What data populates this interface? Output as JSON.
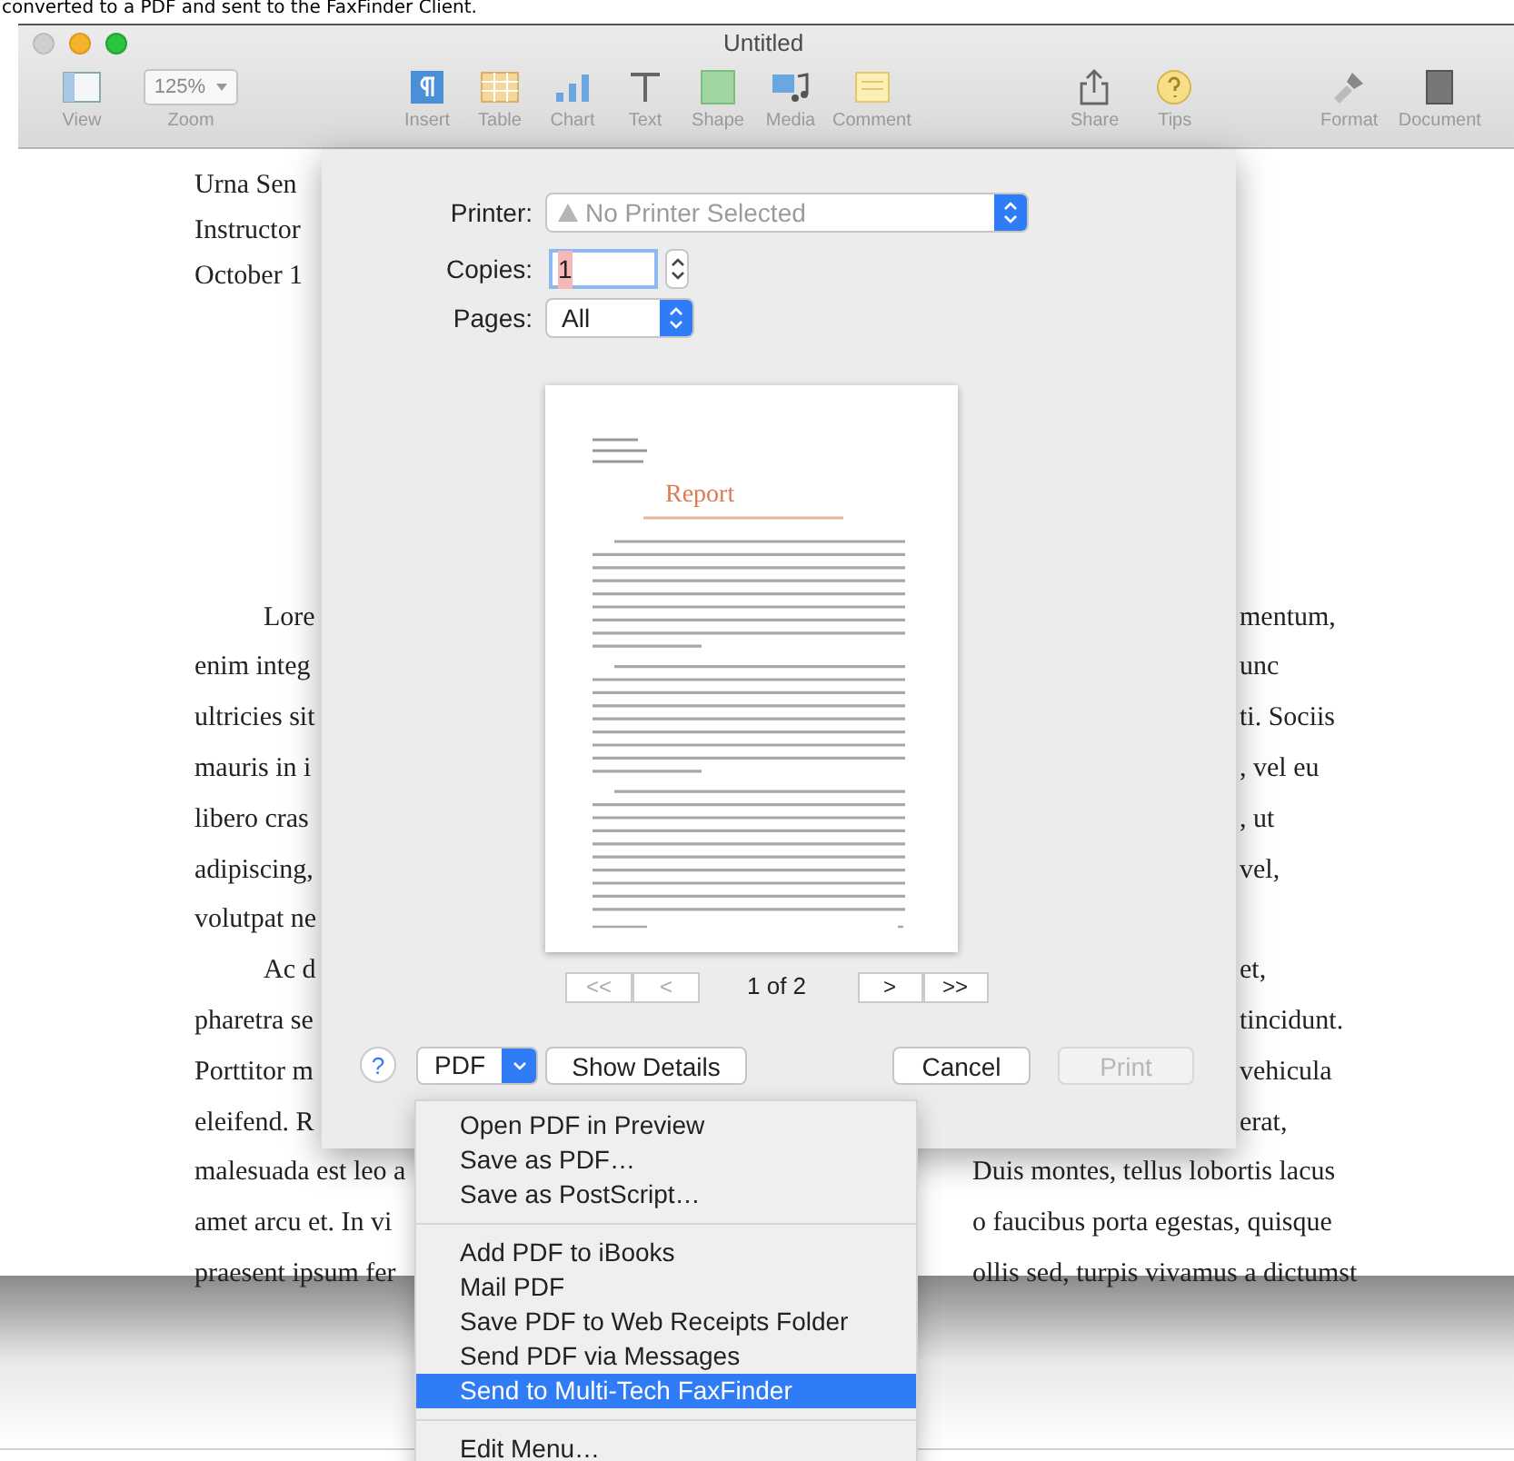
{
  "caption": "converted to a PDF and sent to the FaxFinder Client.",
  "window": {
    "title": "Untitled",
    "toolbar": [
      {
        "items": [
          {
            "kind": "view",
            "label": "View"
          },
          {
            "kind": "zoom",
            "label": "Zoom",
            "value": "125%"
          }
        ]
      },
      {
        "items": [
          {
            "kind": "insert",
            "label": "Insert"
          },
          {
            "kind": "table",
            "label": "Table"
          },
          {
            "kind": "chart",
            "label": "Chart"
          },
          {
            "kind": "text",
            "label": "Text"
          },
          {
            "kind": "shape",
            "label": "Shape"
          },
          {
            "kind": "media",
            "label": "Media"
          },
          {
            "kind": "comment",
            "label": "Comment"
          }
        ]
      },
      {
        "items": [
          {
            "kind": "share",
            "label": "Share"
          },
          {
            "kind": "tips",
            "label": "Tips"
          }
        ]
      },
      {
        "items": [
          {
            "kind": "format",
            "label": "Format"
          },
          {
            "kind": "document",
            "label": "Document"
          }
        ]
      }
    ]
  },
  "document": {
    "header_lines": [
      "Urna Sen",
      "Instructor",
      "October 1"
    ],
    "body_lines": [
      {
        "left": "Lore",
        "right": "mentum,",
        "indent": true
      },
      {
        "left": "enim integ",
        "right": "unc",
        "indent": false
      },
      {
        "left": "ultricies sit",
        "right": "ti. Sociis",
        "indent": false
      },
      {
        "left": "mauris in i",
        "right": ", vel eu",
        "indent": false
      },
      {
        "left": "libero cras",
        "right": ", ut",
        "indent": false
      },
      {
        "left": "adipiscing,",
        "right": "vel,",
        "indent": false
      },
      {
        "left": "volutpat ne",
        "indent": false
      },
      {
        "left": "Ac d",
        "right": "et,",
        "indent": true
      },
      {
        "left": "pharetra se",
        "right": "tincidunt.",
        "indent": false
      },
      {
        "left": "Porttitor m",
        "right": "vehicula",
        "indent": false
      },
      {
        "left": "eleifend. R",
        "right": "erat,",
        "indent": false
      }
    ],
    "lines_below_dialog": [
      {
        "left": "malesuada est leo a",
        "right": "Duis montes, tellus lobortis lacus"
      },
      {
        "left": "amet arcu et. In vi",
        "right": "o faucibus porta egestas, quisque"
      },
      {
        "left": "praesent ipsum fer",
        "right": "ollis sed, turpis vivamus a dictumst"
      }
    ]
  },
  "print_dialog": {
    "printer": {
      "label": "Printer:",
      "value": "No Printer Selected",
      "disabled": true
    },
    "copies": {
      "label": "Copies:",
      "value": "1",
      "selected": true
    },
    "pages": {
      "label": "Pages:",
      "value": "All"
    },
    "preview": {
      "heading": "Report"
    },
    "pager": {
      "text": "1 of 2",
      "back": [
        {
          "symbol": "<<",
          "disabled": true
        },
        {
          "symbol": "<",
          "disabled": true
        }
      ],
      "forward": [
        {
          "symbol": ">",
          "disabled": false
        },
        {
          "symbol": ">>",
          "disabled": false
        }
      ]
    },
    "help": "?",
    "pdf_button": "PDF",
    "show_details": "Show Details",
    "cancel": "Cancel",
    "print": {
      "label": "Print",
      "disabled": true
    }
  },
  "pdf_menu": {
    "groups": [
      [
        {
          "label": "Open PDF in Preview",
          "selected": false
        },
        {
          "label": "Save as PDF…",
          "selected": false
        },
        {
          "label": "Save as PostScript…",
          "selected": false
        }
      ],
      [
        {
          "label": "Add PDF to iBooks",
          "selected": false
        },
        {
          "label": "Mail PDF",
          "selected": false
        },
        {
          "label": "Save PDF to Web Receipts Folder",
          "selected": false
        },
        {
          "label": "Send PDF via Messages",
          "selected": false
        },
        {
          "label": "Send to Multi-Tech FaxFinder",
          "selected": true
        }
      ],
      [
        {
          "label": "Edit Menu…",
          "selected": false
        }
      ]
    ]
  }
}
